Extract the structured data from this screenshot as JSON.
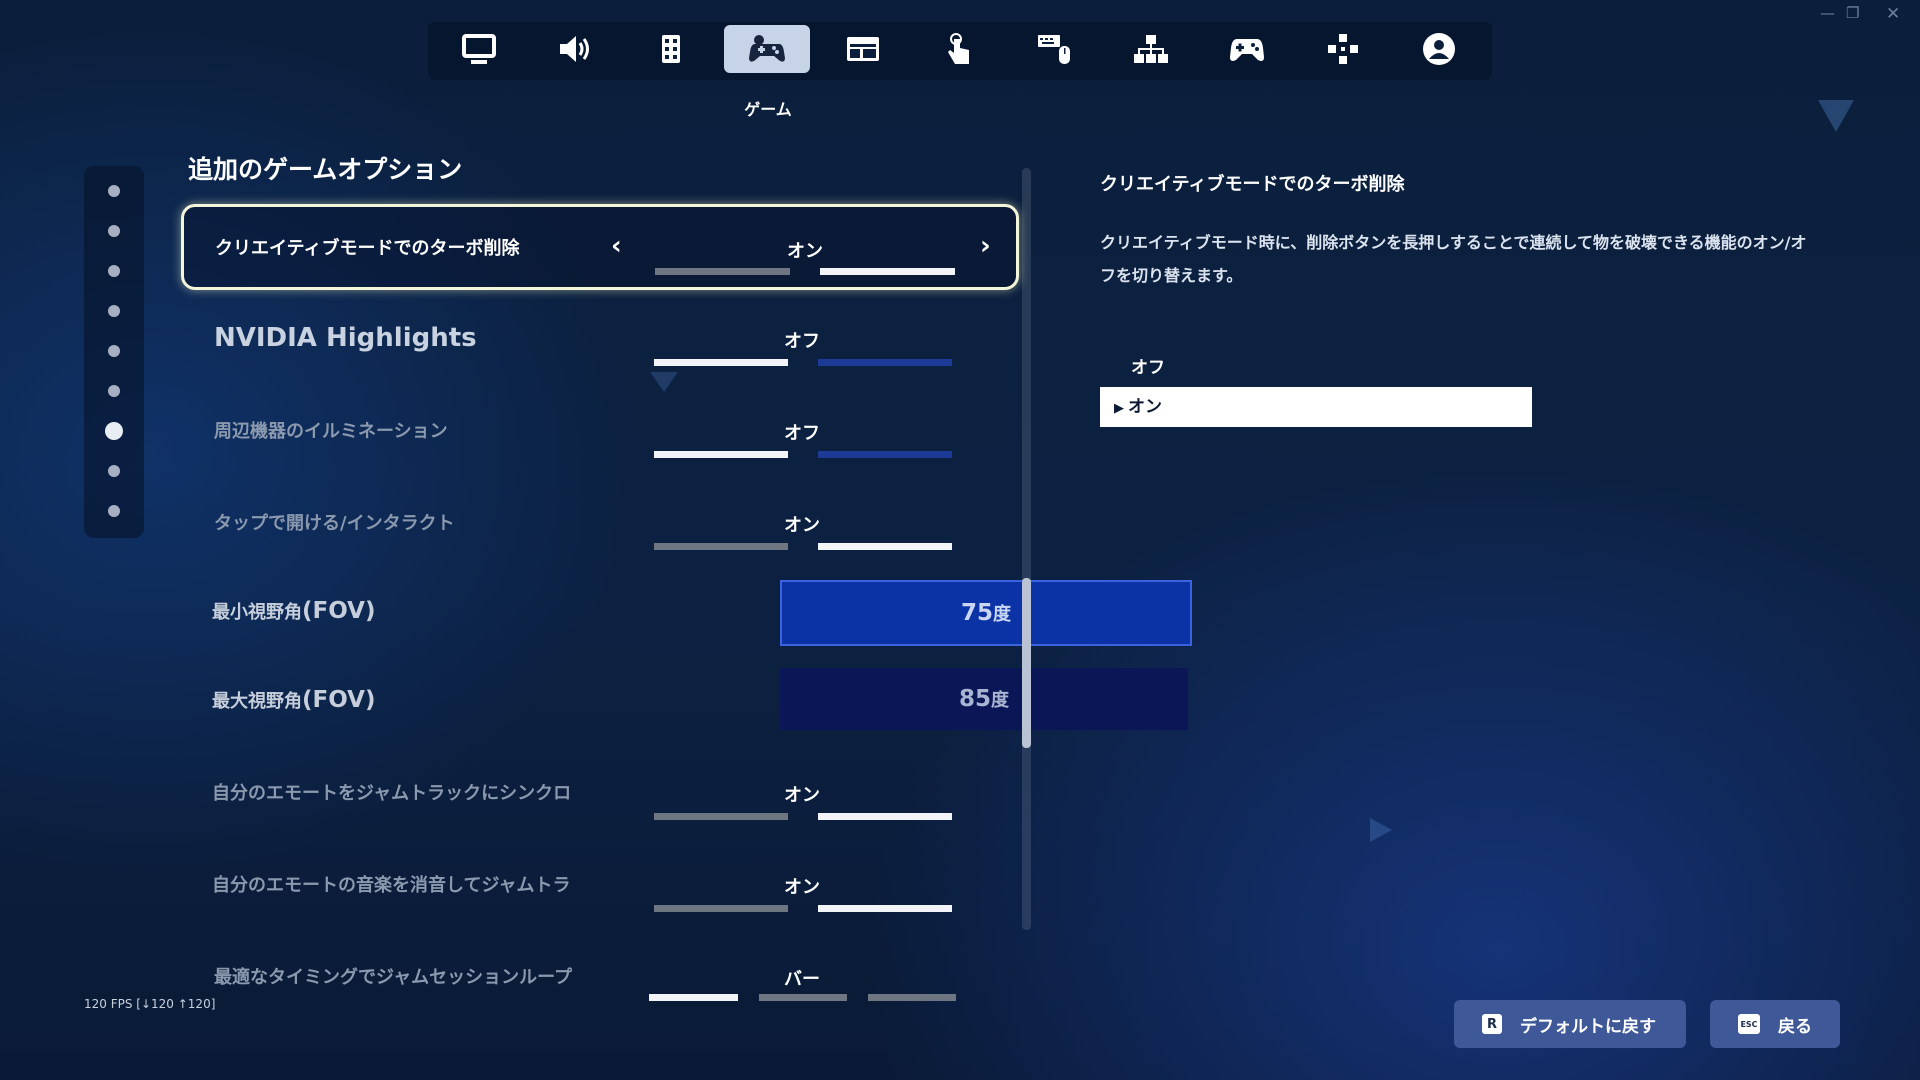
{
  "nav": {
    "items": [
      {
        "icon": "monitor-icon",
        "active": false
      },
      {
        "icon": "speaker-icon",
        "active": false
      },
      {
        "icon": "accessibility-icon",
        "active": false
      },
      {
        "icon": "game-controller-settings-icon",
        "active": true
      },
      {
        "icon": "account-card-icon",
        "active": false
      },
      {
        "icon": "touch-icon",
        "active": false
      },
      {
        "icon": "keyboard-mouse-icon",
        "active": false
      },
      {
        "icon": "network-icon",
        "active": false
      },
      {
        "icon": "gamepad-icon",
        "active": false
      },
      {
        "icon": "controller-buttons-icon",
        "active": false
      },
      {
        "icon": "account-icon",
        "active": false
      }
    ],
    "active_label": "ゲーム"
  },
  "section_title": "追加のゲームオプション",
  "rows": {
    "turbo_delete": {
      "label": "クリエイティブモードでのターボ削除",
      "value": "オン"
    },
    "nvidia": {
      "label": "NVIDIA Highlights",
      "value": "オフ"
    },
    "illumination": {
      "label": "周辺機器のイルミネーション",
      "value": "オフ"
    },
    "tap_open": {
      "label": "タップで開ける/インタラクト",
      "value": "オン"
    },
    "min_fov": {
      "label_prefix": "最小視野角",
      "label_suffix": "(FOV)",
      "value": "75",
      "unit": "度"
    },
    "max_fov": {
      "label_prefix": "最大視野角",
      "label_suffix": "(FOV)",
      "value": "85",
      "unit": "度"
    },
    "emote_sync": {
      "label": "自分のエモートをジャムトラックにシンクロ",
      "value": "オン"
    },
    "emote_mute": {
      "label": "自分のエモートの音楽を消音してジャムトラ",
      "value": "オン"
    },
    "jam_loop": {
      "label": "最適なタイミングでジャムセッションループ",
      "value": "バー"
    }
  },
  "detail": {
    "title": "クリエイティブモードでのターボ削除",
    "description": "クリエイティブモード時に、削除ボタンを長押しすることで連続して物を破壊できる機能のオン/オフを切り替えます。",
    "options": [
      "オフ",
      "オン"
    ],
    "selected_option": "オン"
  },
  "fps_text": "120 FPS [↓120 ↑120]",
  "footer": {
    "default_key": "R",
    "default_label": "デフォルトに戻す",
    "back_key": "ESC",
    "back_label": "戻る"
  },
  "colors": {
    "accent_blue": "#0b33a6",
    "panel_bg": "#0b1f3c",
    "nav_active": "#c7d3e6"
  }
}
